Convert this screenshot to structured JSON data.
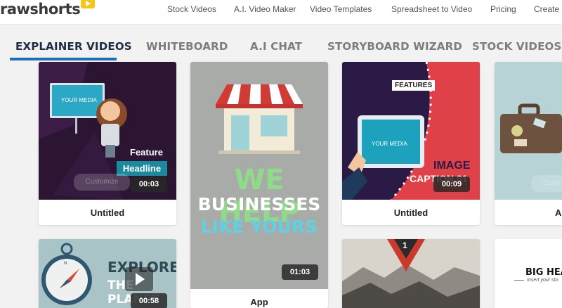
{
  "logo": {
    "text": "rawshorts"
  },
  "nav": [
    {
      "label": "Stock Videos"
    },
    {
      "label": "A.I. Video Maker"
    },
    {
      "label": "Video Templates"
    },
    {
      "label": "Spreadsheet to Video"
    },
    {
      "label": "Pricing"
    },
    {
      "label": "Create"
    }
  ],
  "tabs": [
    {
      "label": "EXPLAINER VIDEOS",
      "active": true
    },
    {
      "label": "WHITEBOARD"
    },
    {
      "label": "A.I CHAT"
    },
    {
      "label": "STORYBOARD WIZARD"
    },
    {
      "label": "STOCK VIDEOS"
    }
  ],
  "cards": [
    {
      "title": "Untitled",
      "duration": "00:03",
      "thumb": {
        "media_label": "YOUR MEDIA",
        "line1": "Feature",
        "line2": "Headline",
        "button": "Customize"
      }
    },
    {
      "title": "App",
      "duration": "01:03",
      "thumb": {
        "line1": "WE HELP",
        "line2": "BUSINESSES",
        "line3": "LIKE YOURS"
      }
    },
    {
      "title": "Untitled",
      "duration": "00:09",
      "thumb": {
        "badge": "FEATURES",
        "media_label": "YOUR MEDIA",
        "line1": "IMAGE",
        "line2": "CAPTION 01"
      }
    },
    {
      "title": "Ap",
      "thumb": {
        "button": "Custo"
      }
    },
    {
      "duration": "00:58",
      "thumb": {
        "line1": "EXPLORE",
        "line2": "THE PLANET"
      }
    },
    {
      "thumb": {
        "number": "1"
      }
    },
    {
      "thumb": {
        "line1": "BIG HEA",
        "line2": "Insert your sto"
      }
    }
  ],
  "colors": {
    "accent": "#1e6fb8",
    "active_tab_text": "#1d2d44",
    "tab_text": "#7d7d7d"
  }
}
